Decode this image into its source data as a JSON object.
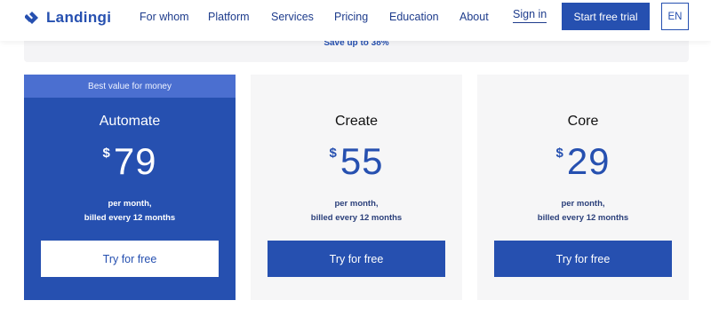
{
  "brand": {
    "name": "Landingi"
  },
  "nav": {
    "links": [
      "For whom",
      "Platform",
      "Services",
      "Pricing",
      "Education",
      "About"
    ],
    "sign_in": "Sign in",
    "cta": "Start free trial",
    "language": "EN"
  },
  "promo": {
    "save_text": "Save up to 38%"
  },
  "plans": [
    {
      "badge": "Best value for money",
      "name": "Automate",
      "currency": "$",
      "price": "79",
      "billing_line1": "per month,",
      "billing_line2": "billed every 12 months",
      "button": "Try for free"
    },
    {
      "name": "Create",
      "currency": "$",
      "price": "55",
      "billing_line1": "per month,",
      "billing_line2": "billed every 12 months",
      "button": "Try for free"
    },
    {
      "name": "Core",
      "currency": "$",
      "price": "29",
      "billing_line1": "per month,",
      "billing_line2": "billed every 12 months",
      "button": "Try for free"
    }
  ],
  "colors": {
    "brand_blue": "#2650b0",
    "badge_blue": "#4b6fd0",
    "card_gray": "#f6f6f7"
  }
}
